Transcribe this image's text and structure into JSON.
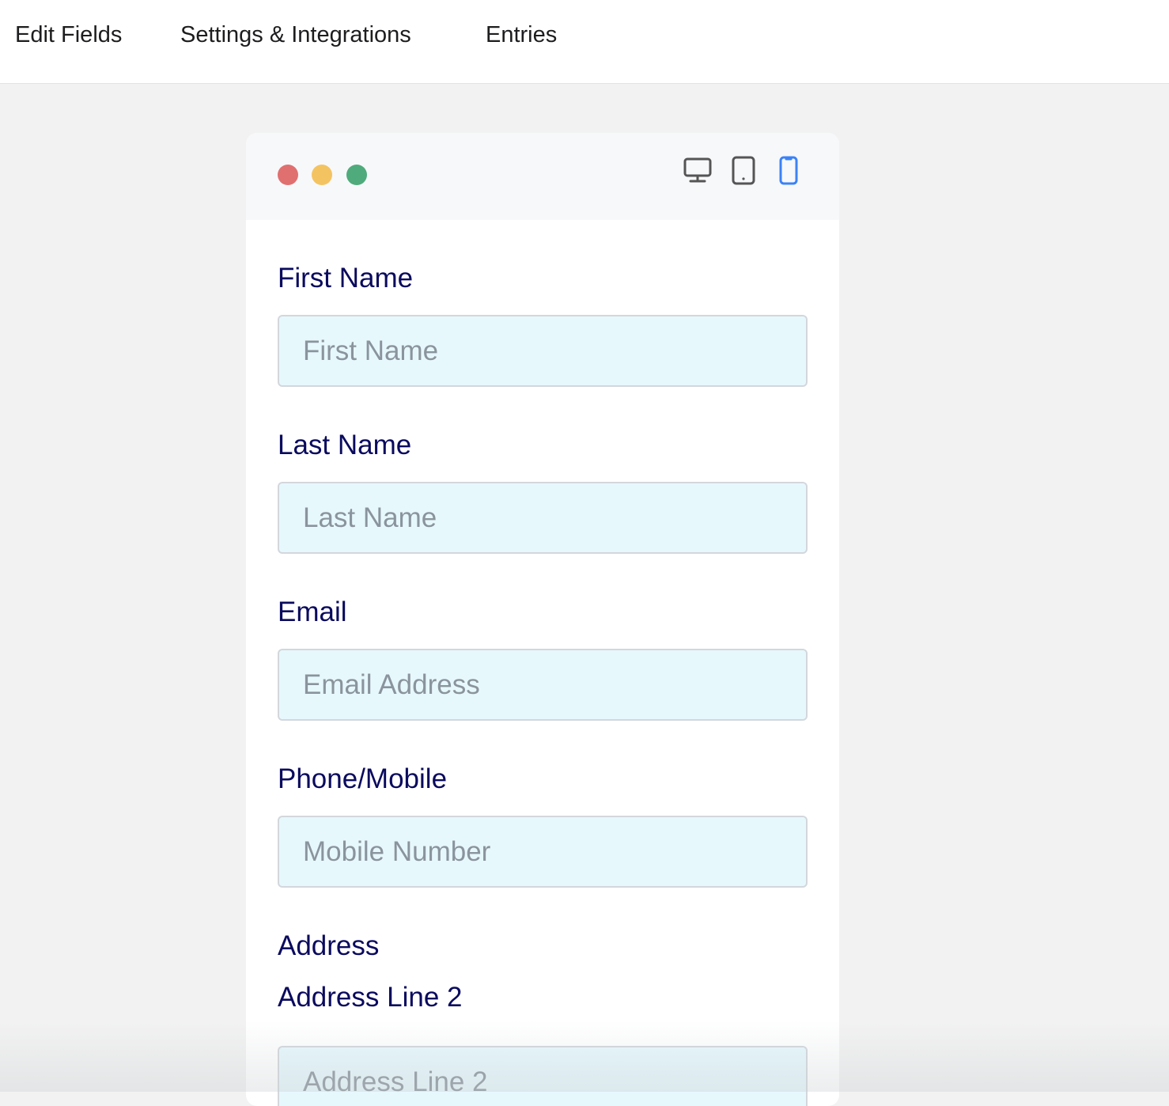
{
  "nav": {
    "tabs": [
      {
        "label": "Edit Fields"
      },
      {
        "label": "Settings & Integrations"
      },
      {
        "label": "Entries"
      }
    ]
  },
  "preview": {
    "window_dots": [
      "#e07070",
      "#f4c361",
      "#4fab7b"
    ],
    "devices": [
      {
        "icon": "desktop-icon",
        "active": false
      },
      {
        "icon": "tablet-icon",
        "active": false
      },
      {
        "icon": "mobile-icon",
        "active": true
      }
    ],
    "accent_color": "#3b82f6"
  },
  "form": {
    "fields": [
      {
        "label": "First Name",
        "placeholder": "First Name",
        "value": ""
      },
      {
        "label": "Last Name",
        "placeholder": "Last Name",
        "value": ""
      },
      {
        "label": "Email",
        "placeholder": "Email Address",
        "value": ""
      },
      {
        "label": "Phone/Mobile",
        "placeholder": "Mobile Number",
        "value": ""
      }
    ],
    "address": {
      "section_label": "Address",
      "line2_label": "Address Line 2",
      "line2_placeholder": "Address Line 2"
    }
  }
}
